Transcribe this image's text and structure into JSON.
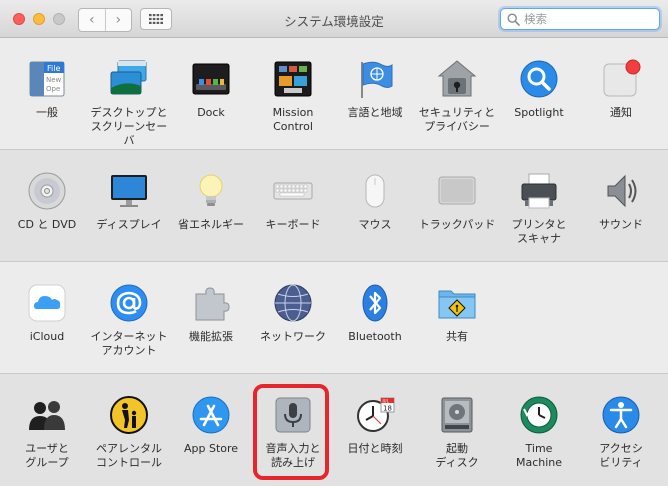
{
  "window": {
    "title": "システム環境設定",
    "search_placeholder": "検索",
    "back_glyph": "‹",
    "forward_glyph": "›",
    "highlight_color": "#e5262c"
  },
  "rows": [
    [
      {
        "id": "general",
        "label": "一般",
        "icon": "general-icon"
      },
      {
        "id": "desktop",
        "label": "デスクトップと\nスクリーンセーバ",
        "icon": "desktop-screensaver-icon"
      },
      {
        "id": "dock",
        "label": "Dock",
        "icon": "dock-icon"
      },
      {
        "id": "mission",
        "label": "Mission\nControl",
        "icon": "mission-control-icon"
      },
      {
        "id": "language",
        "label": "言語と地域",
        "icon": "language-region-icon"
      },
      {
        "id": "security",
        "label": "セキュリティと\nプライバシー",
        "icon": "security-privacy-icon"
      },
      {
        "id": "spotlight",
        "label": "Spotlight",
        "icon": "spotlight-icon"
      },
      {
        "id": "notifications",
        "label": "通知",
        "icon": "notifications-icon"
      }
    ],
    [
      {
        "id": "cddvd",
        "label": "CD と DVD",
        "icon": "cd-dvd-icon"
      },
      {
        "id": "display",
        "label": "ディスプレイ",
        "icon": "display-icon"
      },
      {
        "id": "energy",
        "label": "省エネルギー",
        "icon": "energy-saver-icon"
      },
      {
        "id": "keyboard",
        "label": "キーボード",
        "icon": "keyboard-icon"
      },
      {
        "id": "mouse",
        "label": "マウス",
        "icon": "mouse-icon"
      },
      {
        "id": "trackpad",
        "label": "トラックパッド",
        "icon": "trackpad-icon"
      },
      {
        "id": "printers",
        "label": "プリンタと\nスキャナ",
        "icon": "printer-scanner-icon"
      },
      {
        "id": "sound",
        "label": "サウンド",
        "icon": "sound-icon"
      }
    ],
    [
      {
        "id": "icloud",
        "label": "iCloud",
        "icon": "icloud-icon"
      },
      {
        "id": "internet",
        "label": "インターネット\nアカウント",
        "icon": "internet-accounts-icon"
      },
      {
        "id": "extensions",
        "label": "機能拡張",
        "icon": "extensions-icon"
      },
      {
        "id": "network",
        "label": "ネットワーク",
        "icon": "network-icon"
      },
      {
        "id": "bluetooth",
        "label": "Bluetooth",
        "icon": "bluetooth-icon"
      },
      {
        "id": "sharing",
        "label": "共有",
        "icon": "sharing-icon"
      }
    ],
    [
      {
        "id": "users",
        "label": "ユーザと\nグループ",
        "icon": "users-groups-icon"
      },
      {
        "id": "parental",
        "label": "ペアレンタル\nコントロール",
        "icon": "parental-controls-icon"
      },
      {
        "id": "appstore",
        "label": "App Store",
        "icon": "app-store-icon"
      },
      {
        "id": "dictation",
        "label": "音声入力と\n読み上げ",
        "icon": "dictation-speech-icon"
      },
      {
        "id": "datetime",
        "label": "日付と時刻",
        "icon": "date-time-icon"
      },
      {
        "id": "startup",
        "label": "起動\nディスク",
        "icon": "startup-disk-icon"
      },
      {
        "id": "timemachine",
        "label": "Time\nMachine",
        "icon": "time-machine-icon"
      },
      {
        "id": "accessibility",
        "label": "アクセシ\nビリティ",
        "icon": "accessibility-icon"
      }
    ]
  ],
  "icon_text": {
    "general_file": "File",
    "general_new": "New",
    "general_open": "Ope",
    "calendar_month": "JUL",
    "calendar_day": "18"
  }
}
